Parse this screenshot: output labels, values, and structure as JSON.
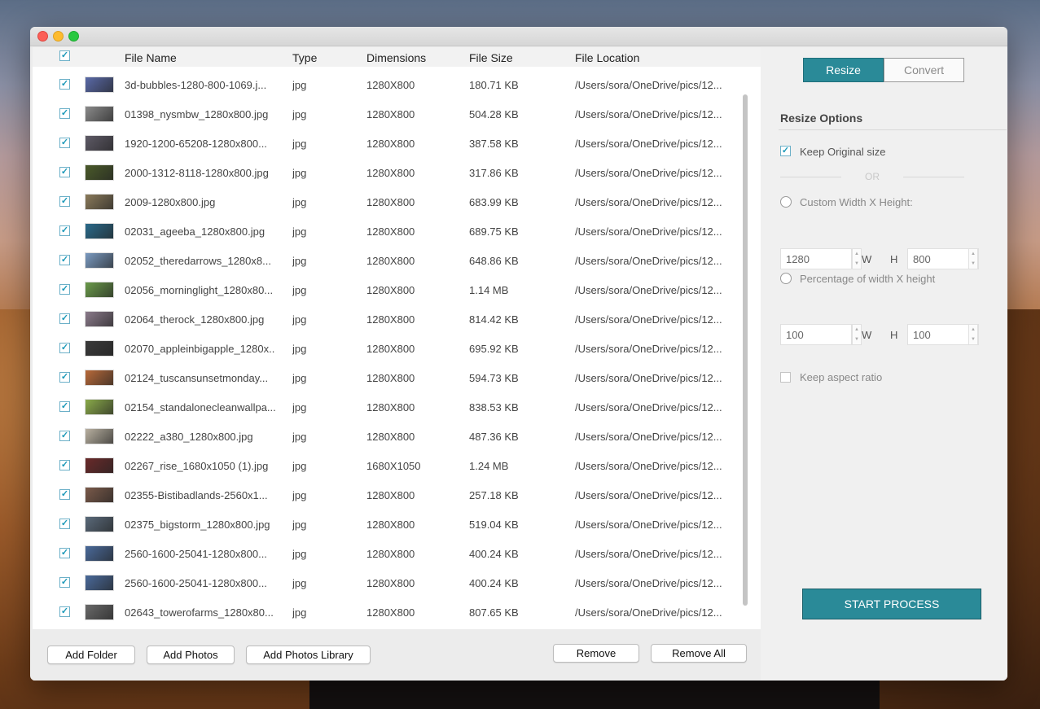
{
  "header": {
    "file_name": "File Name",
    "type": "Type",
    "dimensions": "Dimensions",
    "file_size": "File Size",
    "file_location": "File Location"
  },
  "files": [
    {
      "name": "3d-bubbles-1280-800-1069.j...",
      "type": "jpg",
      "dim": "1280X800",
      "size": "180.71 KB",
      "loc": "/Users/sora/OneDrive/pics/12...",
      "thumb": "#5a6aa8"
    },
    {
      "name": "01398_nysmbw_1280x800.jpg",
      "type": "jpg",
      "dim": "1280X800",
      "size": "504.28 KB",
      "loc": "/Users/sora/OneDrive/pics/12...",
      "thumb": "#8a8a8a"
    },
    {
      "name": "1920-1200-65208-1280x800...",
      "type": "jpg",
      "dim": "1280X800",
      "size": "387.58 KB",
      "loc": "/Users/sora/OneDrive/pics/12...",
      "thumb": "#5e5a66"
    },
    {
      "name": "2000-1312-8118-1280x800.jpg",
      "type": "jpg",
      "dim": "1280X800",
      "size": "317.86 KB",
      "loc": "/Users/sora/OneDrive/pics/12...",
      "thumb": "#4a5a2a"
    },
    {
      "name": "2009-1280x800.jpg",
      "type": "jpg",
      "dim": "1280X800",
      "size": "683.99 KB",
      "loc": "/Users/sora/OneDrive/pics/12...",
      "thumb": "#8a7a5a"
    },
    {
      "name": "02031_ageeba_1280x800.jpg",
      "type": "jpg",
      "dim": "1280X800",
      "size": "689.75 KB",
      "loc": "/Users/sora/OneDrive/pics/12...",
      "thumb": "#2a6a8a"
    },
    {
      "name": "02052_theredarrows_1280x8...",
      "type": "jpg",
      "dim": "1280X800",
      "size": "648.86 KB",
      "loc": "/Users/sora/OneDrive/pics/12...",
      "thumb": "#7a9ac0"
    },
    {
      "name": "02056_morninglight_1280x80...",
      "type": "jpg",
      "dim": "1280X800",
      "size": "1.14 MB",
      "loc": "/Users/sora/OneDrive/pics/12...",
      "thumb": "#6a9a4a"
    },
    {
      "name": "02064_therock_1280x800.jpg",
      "type": "jpg",
      "dim": "1280X800",
      "size": "814.42 KB",
      "loc": "/Users/sora/OneDrive/pics/12...",
      "thumb": "#8a7a8a"
    },
    {
      "name": "02070_appleinbigapple_1280x...",
      "type": "jpg",
      "dim": "1280X800",
      "size": "695.92 KB",
      "loc": "/Users/sora/OneDrive/pics/12...",
      "thumb": "#3a3a3a"
    },
    {
      "name": "02124_tuscansunsetmonday...",
      "type": "jpg",
      "dim": "1280X800",
      "size": "594.73 KB",
      "loc": "/Users/sora/OneDrive/pics/12...",
      "thumb": "#b86a3a"
    },
    {
      "name": "02154_standalonecleanwallpa...",
      "type": "jpg",
      "dim": "1280X800",
      "size": "838.53 KB",
      "loc": "/Users/sora/OneDrive/pics/12...",
      "thumb": "#8aaa4a"
    },
    {
      "name": "02222_a380_1280x800.jpg",
      "type": "jpg",
      "dim": "1280X800",
      "size": "487.36 KB",
      "loc": "/Users/sora/OneDrive/pics/12...",
      "thumb": "#b8b0a0"
    },
    {
      "name": "02267_rise_1680x1050 (1).jpg",
      "type": "jpg",
      "dim": "1680X1050",
      "size": "1.24 MB",
      "loc": "/Users/sora/OneDrive/pics/12...",
      "thumb": "#6a2a2a"
    },
    {
      "name": "02355-Bistibadlands-2560x1...",
      "type": "jpg",
      "dim": "1280X800",
      "size": "257.18 KB",
      "loc": "/Users/sora/OneDrive/pics/12...",
      "thumb": "#7a5a4a"
    },
    {
      "name": "02375_bigstorm_1280x800.jpg",
      "type": "jpg",
      "dim": "1280X800",
      "size": "519.04 KB",
      "loc": "/Users/sora/OneDrive/pics/12...",
      "thumb": "#5a6a7a"
    },
    {
      "name": "2560-1600-25041-1280x800...",
      "type": "jpg",
      "dim": "1280X800",
      "size": "400.24 KB",
      "loc": "/Users/sora/OneDrive/pics/12...",
      "thumb": "#4a6a9a"
    },
    {
      "name": "2560-1600-25041-1280x800...",
      "type": "jpg",
      "dim": "1280X800",
      "size": "400.24 KB",
      "loc": "/Users/sora/OneDrive/pics/12...",
      "thumb": "#4a6a9a"
    },
    {
      "name": "02643_towerofarms_1280x80...",
      "type": "jpg",
      "dim": "1280X800",
      "size": "807.65 KB",
      "loc": "/Users/sora/OneDrive/pics/12...",
      "thumb": "#6a6a6a"
    }
  ],
  "bottom": {
    "add_folder": "Add Folder",
    "add_photos": "Add Photos",
    "add_photos_library": "Add Photos Library",
    "remove": "Remove",
    "remove_all": "Remove All"
  },
  "tabs": {
    "resize": "Resize",
    "convert": "Convert"
  },
  "options": {
    "title": "Resize Options",
    "keep_original": "Keep Original size",
    "or": "OR",
    "custom": "Custom Width X Height:",
    "width_value": "1280",
    "height_value": "800",
    "w": "W",
    "h": "H",
    "percentage": "Percentage of width X height",
    "pct_w_value": "100",
    "pct_h_value": "100",
    "keep_aspect": "Keep aspect ratio"
  },
  "start": "START PROCESS",
  "check_glyph": "✓",
  "colors": {
    "accent": "#2a8a98",
    "check": "#1a98b8"
  }
}
